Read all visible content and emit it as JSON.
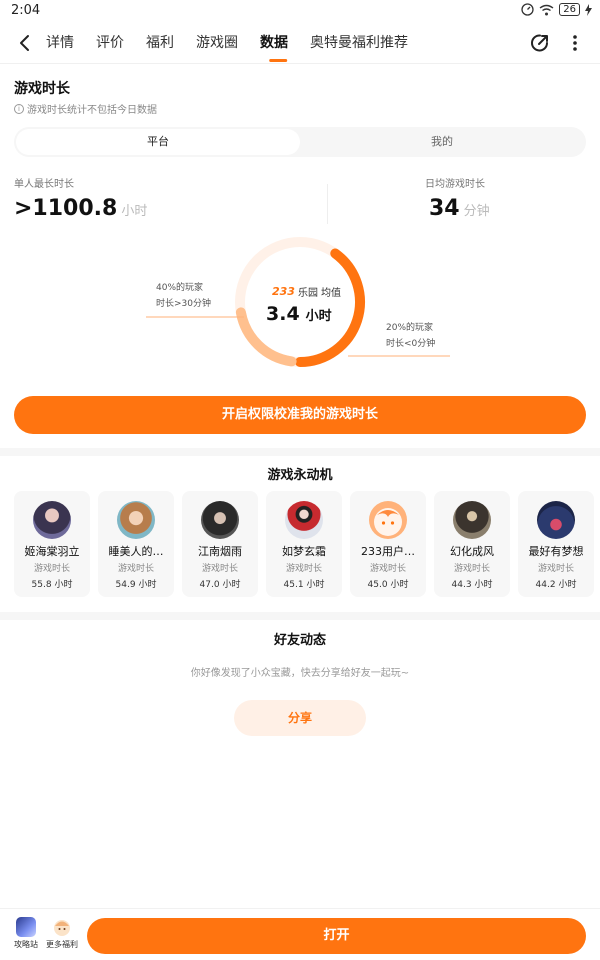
{
  "status": {
    "time": "2:04",
    "battery": "26"
  },
  "nav": {
    "tabs": [
      {
        "label": "详情",
        "active": false
      },
      {
        "label": "评价",
        "active": false
      },
      {
        "label": "福利",
        "active": false
      },
      {
        "label": "游戏圈",
        "active": false
      },
      {
        "label": "数据",
        "active": true
      },
      {
        "label": "奥特曼福利推荐",
        "active": false
      }
    ]
  },
  "playtime": {
    "title": "游戏时长",
    "note": "游戏时长统计不包括今日数据",
    "segments": [
      {
        "label": "平台",
        "active": true
      },
      {
        "label": "我的",
        "active": false
      }
    ],
    "max_single": {
      "label": "单人最长时长",
      "value": ">1100.8",
      "unit": "小时"
    },
    "daily_avg": {
      "label": "日均游戏时长",
      "value": "34",
      "unit": "分钟"
    },
    "donut": {
      "brand": "233",
      "brand_suffix": "乐园",
      "caption": "均值",
      "value": "3.4",
      "unit": "小时",
      "left_annotation": [
        "40%的玩家",
        "时长>30分钟"
      ],
      "right_annotation": [
        "20%的玩家",
        "时长<0分钟"
      ],
      "share_over_30min": 0.4,
      "share_under_0min": 0.2
    },
    "cta_label": "开启权限校准我的游戏时长"
  },
  "players": {
    "title": "游戏永动机",
    "items": [
      {
        "name": "姬海棠羽立",
        "sub": "游戏时长",
        "hours": "55.8 小时",
        "avatar": "anime-girl-dark-avatar"
      },
      {
        "name": "睡美人的…",
        "sub": "游戏时长",
        "hours": "54.9 小时",
        "avatar": "anime-boy-avatar"
      },
      {
        "name": "江南烟雨",
        "sub": "游戏时长",
        "hours": "47.0 小时",
        "avatar": "dark-boy-avatar"
      },
      {
        "name": "如梦玄霜",
        "sub": "游戏时长",
        "hours": "45.1 小时",
        "avatar": "girl-red-dress-avatar"
      },
      {
        "name": "233用户…",
        "sub": "游戏时长",
        "hours": "45.0 小时",
        "avatar": "default-orange-avatar"
      },
      {
        "name": "幻化成风",
        "sub": "游戏时长",
        "hours": "44.3 小时",
        "avatar": "dark-figure-avatar"
      },
      {
        "name": "最好有梦想",
        "sub": "游戏时长",
        "hours": "44.2 小时",
        "avatar": "night-sky-avatar"
      }
    ]
  },
  "friends": {
    "title": "好友动态",
    "empty_text": "你好像发现了小众宝藏，快去分享给好友一起玩~",
    "share_label": "分享"
  },
  "bottom": {
    "items": [
      {
        "label": "攻略站",
        "icon": "guide-icon"
      },
      {
        "label": "更多福利",
        "icon": "gift-character-icon"
      }
    ],
    "open_label": "打开"
  },
  "colors": {
    "accent": "#ff7410",
    "accent_light": "#ffc08e",
    "track": "#fff1e8"
  }
}
